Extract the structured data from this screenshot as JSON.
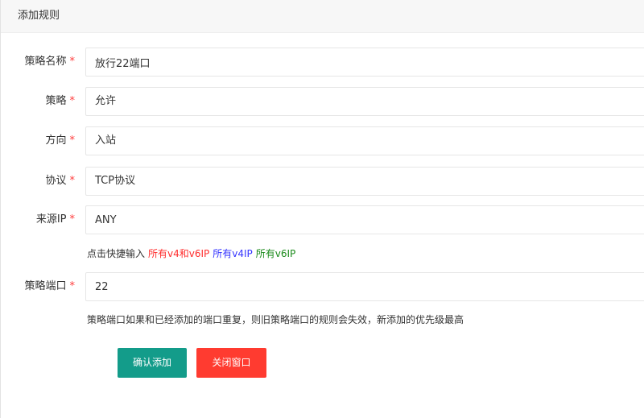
{
  "dialog": {
    "title": "添加规则"
  },
  "form": {
    "required_mark": "*",
    "fields": [
      {
        "label": "策略名称",
        "value": "放行22端口"
      },
      {
        "label": "策略",
        "value": "允许"
      },
      {
        "label": "方向",
        "value": "入站"
      },
      {
        "label": "协议",
        "value": "TCP协议"
      },
      {
        "label": "来源IP",
        "value": "ANY"
      },
      {
        "label": "策略端口",
        "value": "22"
      }
    ],
    "quick_input": {
      "prefix": "点击快捷输入",
      "all": "所有v4和v6IP",
      "v4": "所有v4IP",
      "v6": "所有v6IP"
    },
    "port_hint": "策略端口如果和已经添加的端口重复，则旧策略端口的规则会失效，新添加的优先级最高"
  },
  "buttons": {
    "confirm": "确认添加",
    "close": "关闭窗口"
  },
  "colors": {
    "confirm_bg": "#139c8a",
    "close_bg": "#ff3b30",
    "required": "#ff3b3b",
    "quick_all": "#ff2d2d",
    "quick_v4": "#3333ff",
    "quick_v6": "#1a8a1a"
  }
}
